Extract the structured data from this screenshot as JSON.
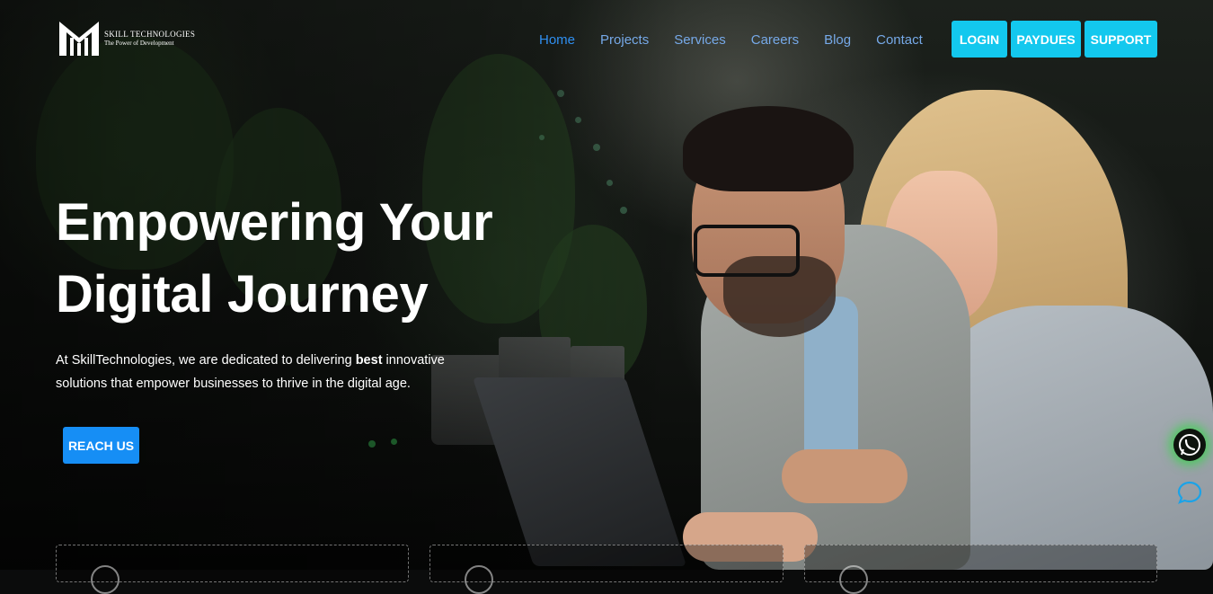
{
  "brand": {
    "name": "SKILL TECHNOLOGIES",
    "tagline": "The Power of Development"
  },
  "nav": {
    "items": [
      {
        "label": "Home",
        "active": true
      },
      {
        "label": "Projects"
      },
      {
        "label": "Services"
      },
      {
        "label": "Careers"
      },
      {
        "label": "Blog"
      },
      {
        "label": "Contact"
      }
    ]
  },
  "header_buttons": {
    "login": "LOGIN",
    "paydues": "PAYDUES",
    "support": "SUPPORT"
  },
  "hero": {
    "headline_line1": "Empowering Your",
    "headline_line2": "Digital Journey",
    "desc_part1": "At SkillTechnologies, we are dedicated to delivering ",
    "desc_bold": "best",
    "desc_part2": " innovative solutions that empower businesses to thrive in the digital age.",
    "cta": "REACH US"
  },
  "icons": {
    "whatsapp": "whatsapp-icon",
    "chat": "chat-bubble-icon"
  },
  "colors": {
    "nav_link": "#76a9e8",
    "nav_active": "#2f8ff0",
    "header_button": "#13c8ee",
    "cta_button": "#168ef5",
    "whatsapp_glow": "#28dc3c"
  }
}
